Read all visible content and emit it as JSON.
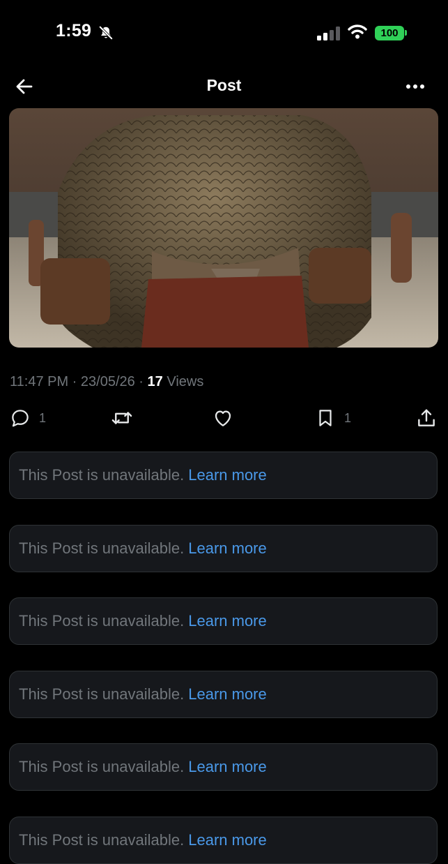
{
  "status_bar": {
    "time": "1:59",
    "battery": "100",
    "icons": [
      "bell-slash-icon",
      "signal-icon",
      "wifi-icon",
      "battery-icon"
    ]
  },
  "header": {
    "title": "Post",
    "back_icon": "arrow-left-icon",
    "more_icon": "more-horizontal-icon"
  },
  "post": {
    "image_alt": "Reptilian gladiator in an arena",
    "timestamp": "11:47 PM · 23/05/26 · ",
    "views_count": "17",
    "views_label": " Views"
  },
  "actions": {
    "reply_count": "1",
    "bookmark_count": "1",
    "icons": [
      "reply-icon",
      "repost-icon",
      "like-icon",
      "bookmark-icon",
      "share-icon"
    ]
  },
  "unavailable": {
    "message": "This Post is unavailable.",
    "link": "Learn more",
    "count": 6
  },
  "colors": {
    "background": "#000000",
    "card": "#16181c",
    "muted": "#71767b",
    "link": "#4a99e9",
    "battery": "#30d158"
  }
}
